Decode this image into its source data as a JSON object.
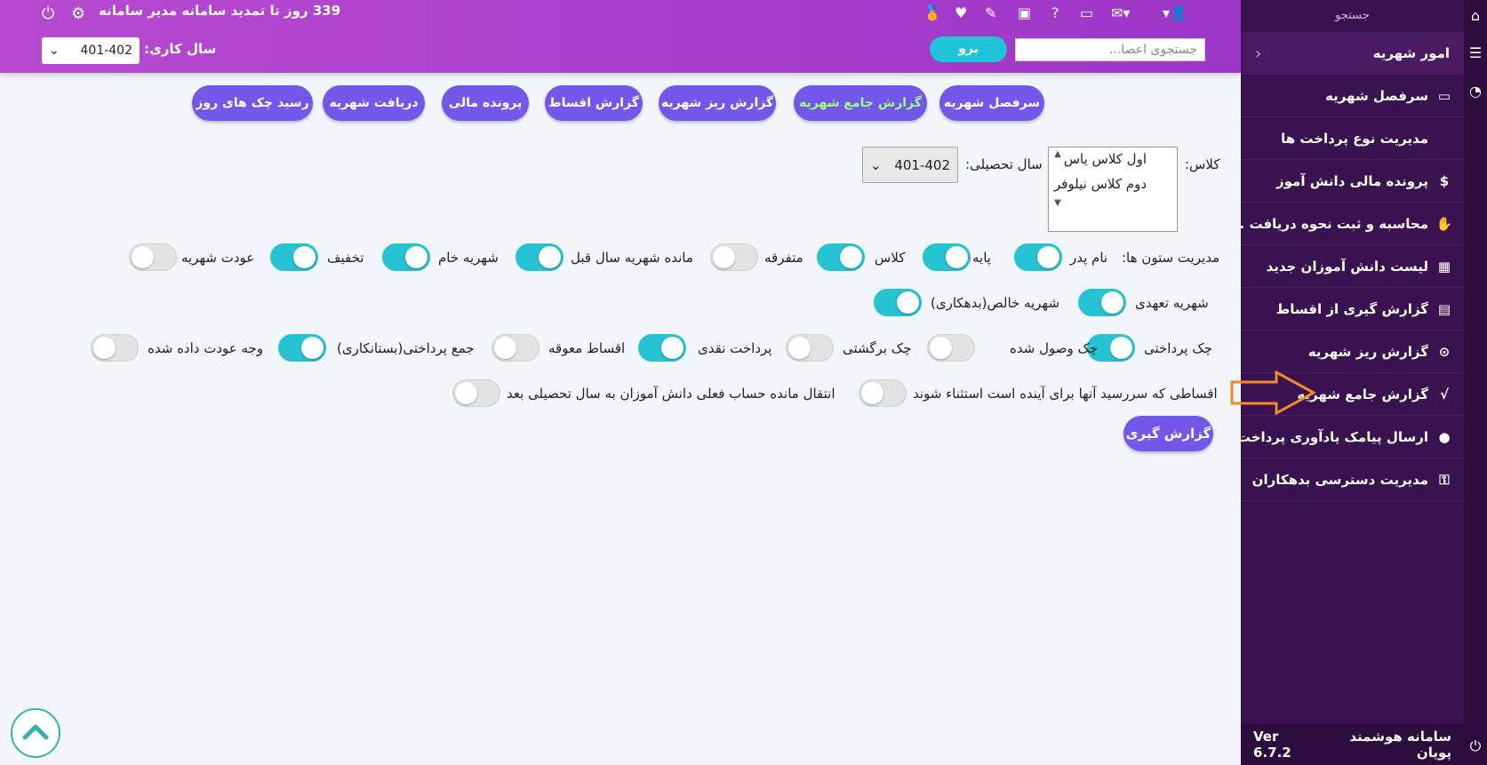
{
  "header": {
    "days_notice": "339 روز تا تمدید سامانه مدیر سامانه",
    "year_label": "سال کاری:",
    "year_value": "401-402",
    "search_placeholder": "جستجوی اعضا...",
    "go_label": "برو",
    "icons": [
      "user-gear-icon",
      "envelope-icon",
      "folder-icon",
      "help-icon",
      "ticket-icon",
      "edit-icon",
      "heartbeat-icon",
      "medal-icon",
      "gear-icon",
      "power-icon"
    ]
  },
  "sidebar": {
    "search_label": "جستجو",
    "section_title": "امور شهریه",
    "items": [
      {
        "label": "سرفصل شهریه",
        "icon": "id-card-icon"
      },
      {
        "label": "مدیریت نوع پرداخت ها",
        "icon": ""
      },
      {
        "label": "پرونده مالی دانش آموز",
        "icon": "dollar-icon"
      },
      {
        "label": "محاسبه و ثبت نحوه دریافت ...",
        "icon": "hand-money-icon"
      },
      {
        "label": "لیست دانش آموزان جدید",
        "icon": "table-icon"
      },
      {
        "label": "گزارش گیری از اقساط",
        "icon": "scroll-icon"
      },
      {
        "label": "گزارش ریز شهریه",
        "icon": "search-dollar-icon"
      },
      {
        "label": "گزارش جامع شهریه",
        "icon": "square-root-icon"
      },
      {
        "label": "ارسال پیامک یادآوری پرداخت",
        "icon": "sms-icon"
      },
      {
        "label": "مدیریت دسترسی بدهکاران",
        "icon": "user-lock-icon"
      }
    ],
    "footer_title": "سامانه هوشمند پویان",
    "version": "Ver 6.7.2"
  },
  "top_buttons": [
    {
      "label": "سرفصل شهریه",
      "active": false
    },
    {
      "label": "گزارش جامع شهریه",
      "active": true
    },
    {
      "label": "گزارش ریز شهریه",
      "active": false
    },
    {
      "label": "گزارش اقساط",
      "active": false
    },
    {
      "label": "پرونده مالی",
      "active": false
    },
    {
      "label": "دریافت شهریه",
      "active": false
    },
    {
      "label": "رسید چک های روز",
      "active": false
    }
  ],
  "form": {
    "class_label": "کلاس:",
    "class_options": [
      "اول کلاس یاس",
      "دوم کلاس نیلوفر"
    ],
    "year_label": "سال تحصیلی:",
    "year_value": "401-402",
    "columns_label": "مدیریت ستون ها:",
    "toggles_row1": [
      {
        "label": "نام پدر",
        "on": true
      },
      {
        "label": "پایه",
        "on": true
      },
      {
        "label": "کلاس",
        "on": true
      },
      {
        "label": "متفرقه",
        "on": false
      },
      {
        "label": "مانده شهریه سال قبل",
        "on": true
      },
      {
        "label": "شهریه خام",
        "on": true
      },
      {
        "label": "تخفیف",
        "on": true
      },
      {
        "label": "عودت شهریه",
        "on": false
      }
    ],
    "toggles_row2": [
      {
        "label": "شهریه تعهدی",
        "on": true
      },
      {
        "label": "شهریه خالص(بدهکاری)",
        "on": true
      }
    ],
    "toggles_row3": [
      {
        "label": "چک پرداختی",
        "on": true
      },
      {
        "label": "چک وصول شده",
        "on": false
      },
      {
        "label": "چک برگشتی",
        "on": false
      },
      {
        "label": "پرداخت نقدی",
        "on": true
      },
      {
        "label": "اقساط معوقه",
        "on": false
      },
      {
        "label": "جمع پرداختی(بستانکاری)",
        "on": true
      },
      {
        "label": "وجه عودت داده شده",
        "on": false
      }
    ],
    "toggles_row4": [
      {
        "label": "اقساطی که سررسید آنها برای آینده است استثناء شوند",
        "on": false
      },
      {
        "label": "انتقال مانده حساب فعلی دانش آموزان به سال تحصیلی بعد",
        "on": false
      }
    ],
    "report_button": "گزارش گیری"
  },
  "colors": {
    "header": "#a43dcc",
    "sidebar": "#3b1250",
    "button": "#7357e8",
    "toggle_on": "#25c3d3",
    "arrow": "#f08a24"
  }
}
